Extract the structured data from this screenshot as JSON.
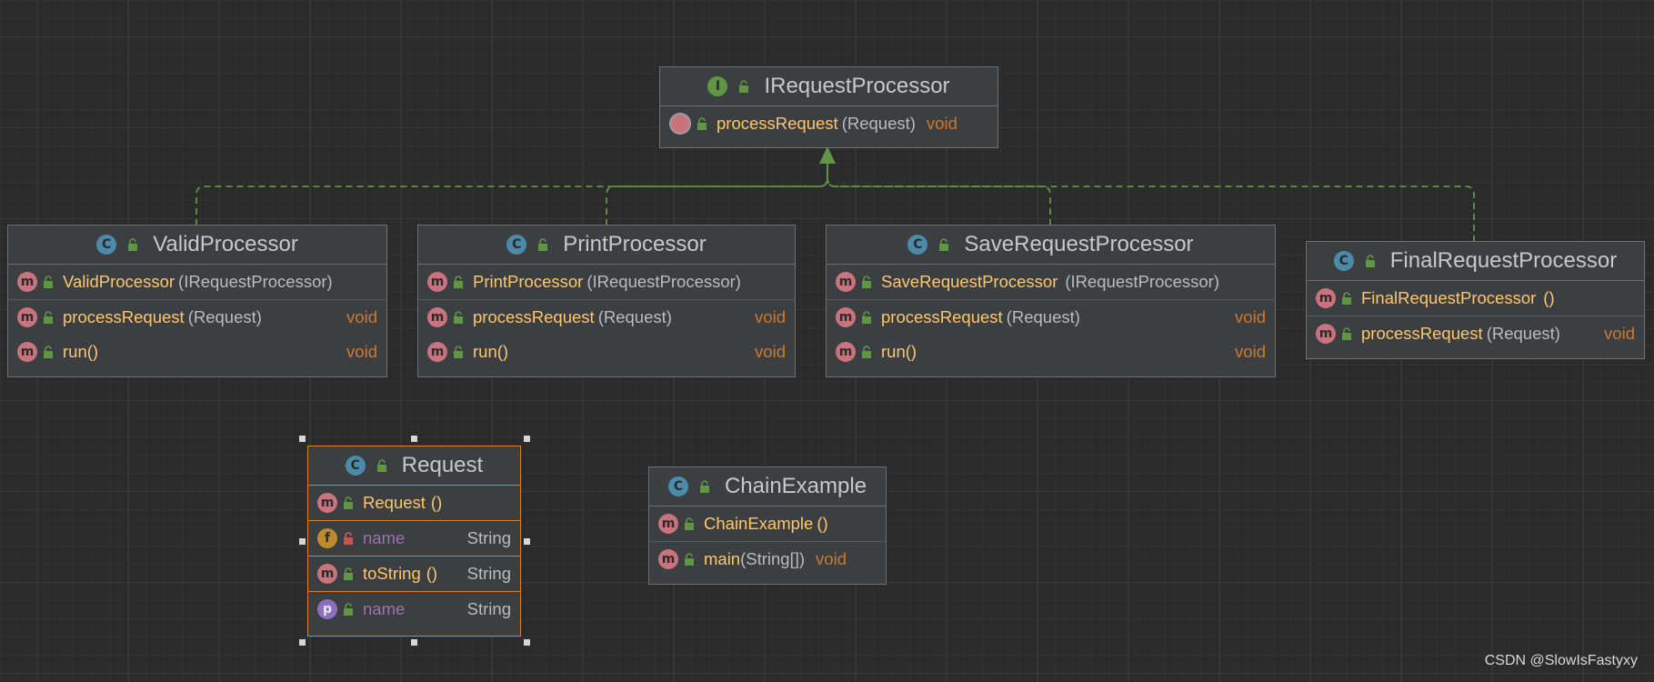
{
  "diagram": {
    "interface": {
      "name": "IRequestProcessor",
      "kind": "I",
      "methods": [
        {
          "name": "processRequest",
          "params": "(Request)",
          "return": "void"
        }
      ]
    },
    "valid": {
      "name": "ValidProcessor",
      "kind": "C",
      "ctor": {
        "name": "ValidProcessor",
        "params": "(IRequestProcessor)"
      },
      "m1": {
        "name": "processRequest",
        "params": "(Request)",
        "return": "void"
      },
      "m2": {
        "name": "run",
        "paren": "()",
        "return": "void"
      }
    },
    "print": {
      "name": "PrintProcessor",
      "kind": "C",
      "ctor": {
        "name": "PrintProcessor",
        "params": "(IRequestProcessor)"
      },
      "m1": {
        "name": "processRequest",
        "params": "(Request)",
        "return": "void"
      },
      "m2": {
        "name": "run",
        "paren": "()",
        "return": "void"
      }
    },
    "save": {
      "name": "SaveRequestProcessor",
      "kind": "C",
      "ctor": {
        "name": "SaveRequestProcessor",
        "params": "(IRequestProcessor)"
      },
      "m1": {
        "name": "processRequest",
        "params": "(Request)",
        "return": "void"
      },
      "m2": {
        "name": "run",
        "paren": "()",
        "return": "void"
      }
    },
    "final": {
      "name": "FinalRequestProcessor",
      "kind": "C",
      "ctor": {
        "name": "FinalRequestProcessor",
        "paren": "()"
      },
      "m1": {
        "name": "processRequest",
        "params": "(Request)",
        "return": "void"
      }
    },
    "request": {
      "name": "Request",
      "kind": "C",
      "ctor": {
        "name": "Request",
        "paren": "()"
      },
      "field": {
        "badge": "f",
        "name": "name",
        "type": "String"
      },
      "m1": {
        "name": "toString",
        "paren": "()",
        "return": "String"
      },
      "prop": {
        "badge": "p",
        "name": "name",
        "type": "String"
      }
    },
    "chain": {
      "name": "ChainExample",
      "kind": "C",
      "ctor": {
        "name": "ChainExample",
        "paren": "()"
      },
      "main": {
        "name": "main",
        "params": "(String[])",
        "return": "void"
      }
    },
    "badge_m": "m"
  },
  "watermark": "CSDN @SlowIsFastyxy",
  "colors": {
    "background": "#2b2b2b",
    "node_fill": "#3c3f41",
    "edge": "#5f9643",
    "method_name": "#ffc66d",
    "keyword": "#cc7832",
    "field_name": "#9876aa",
    "selection": "#d2822a"
  }
}
